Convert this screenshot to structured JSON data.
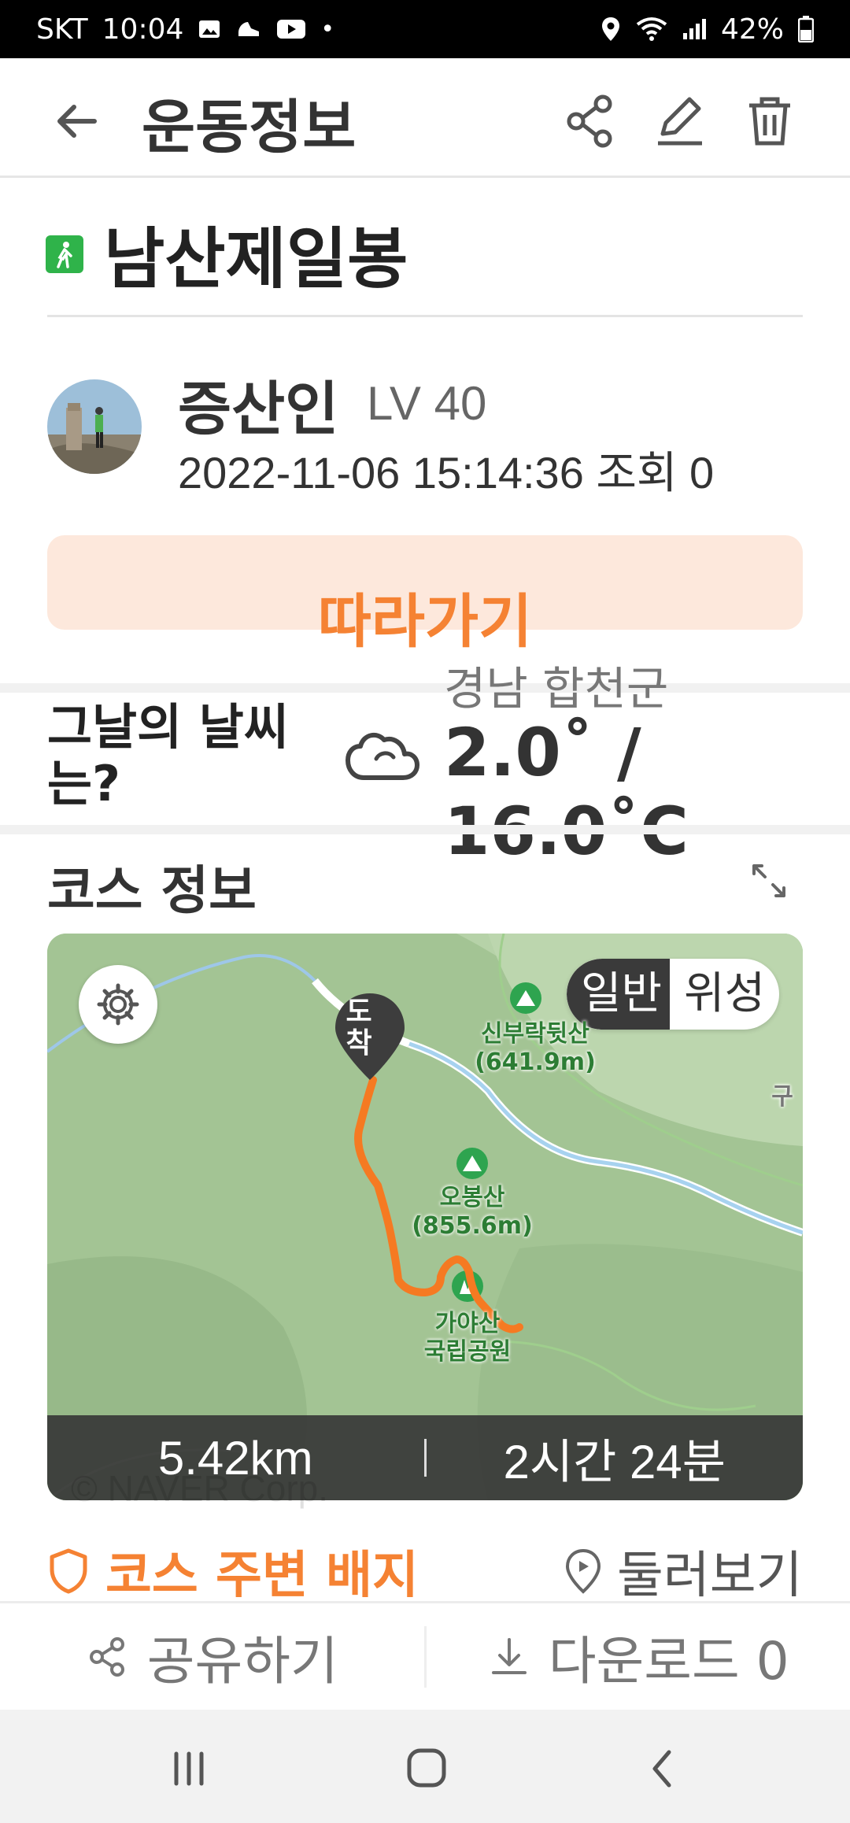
{
  "status": {
    "carrier": "SKT",
    "time": "10:04",
    "battery": "42%"
  },
  "header": {
    "title": "운동정보",
    "back_icon": "arrow-left-icon",
    "share_icon": "share-icon",
    "edit_icon": "pencil-icon",
    "delete_icon": "trash-icon"
  },
  "trail": {
    "title": "남산제일봉"
  },
  "author": {
    "name": "증산인",
    "level": "LV 40",
    "meta": "2022-11-06 15:14:36 조회 0"
  },
  "follow": {
    "label": "따라가기"
  },
  "weather": {
    "question": "그날의 날씨는?",
    "location": "경남 합천군",
    "temp": "2.0˚ / 16.0˚C"
  },
  "course": {
    "title": "코스 정보",
    "map_toggle": {
      "normal": "일반",
      "satellite": "위성"
    },
    "pin": "도착",
    "labels": [
      {
        "name": "신부락뒷산\n(641.9m)"
      },
      {
        "name": "오봉산\n(855.6m)"
      },
      {
        "name": "가야산\n국립공원"
      },
      {
        "name": "구"
      }
    ],
    "distance": "5.42km",
    "duration": "2시간 24분",
    "copyright": "© NAVER Corp."
  },
  "badges": {
    "label": "코스 주변 배지",
    "lookaround": "둘러보기"
  },
  "actions": {
    "share": "공유하기",
    "download": "다운로드 0"
  },
  "colors": {
    "accent": "#f58233",
    "follow_bg": "#fde8dc",
    "route": "#f57a22"
  }
}
